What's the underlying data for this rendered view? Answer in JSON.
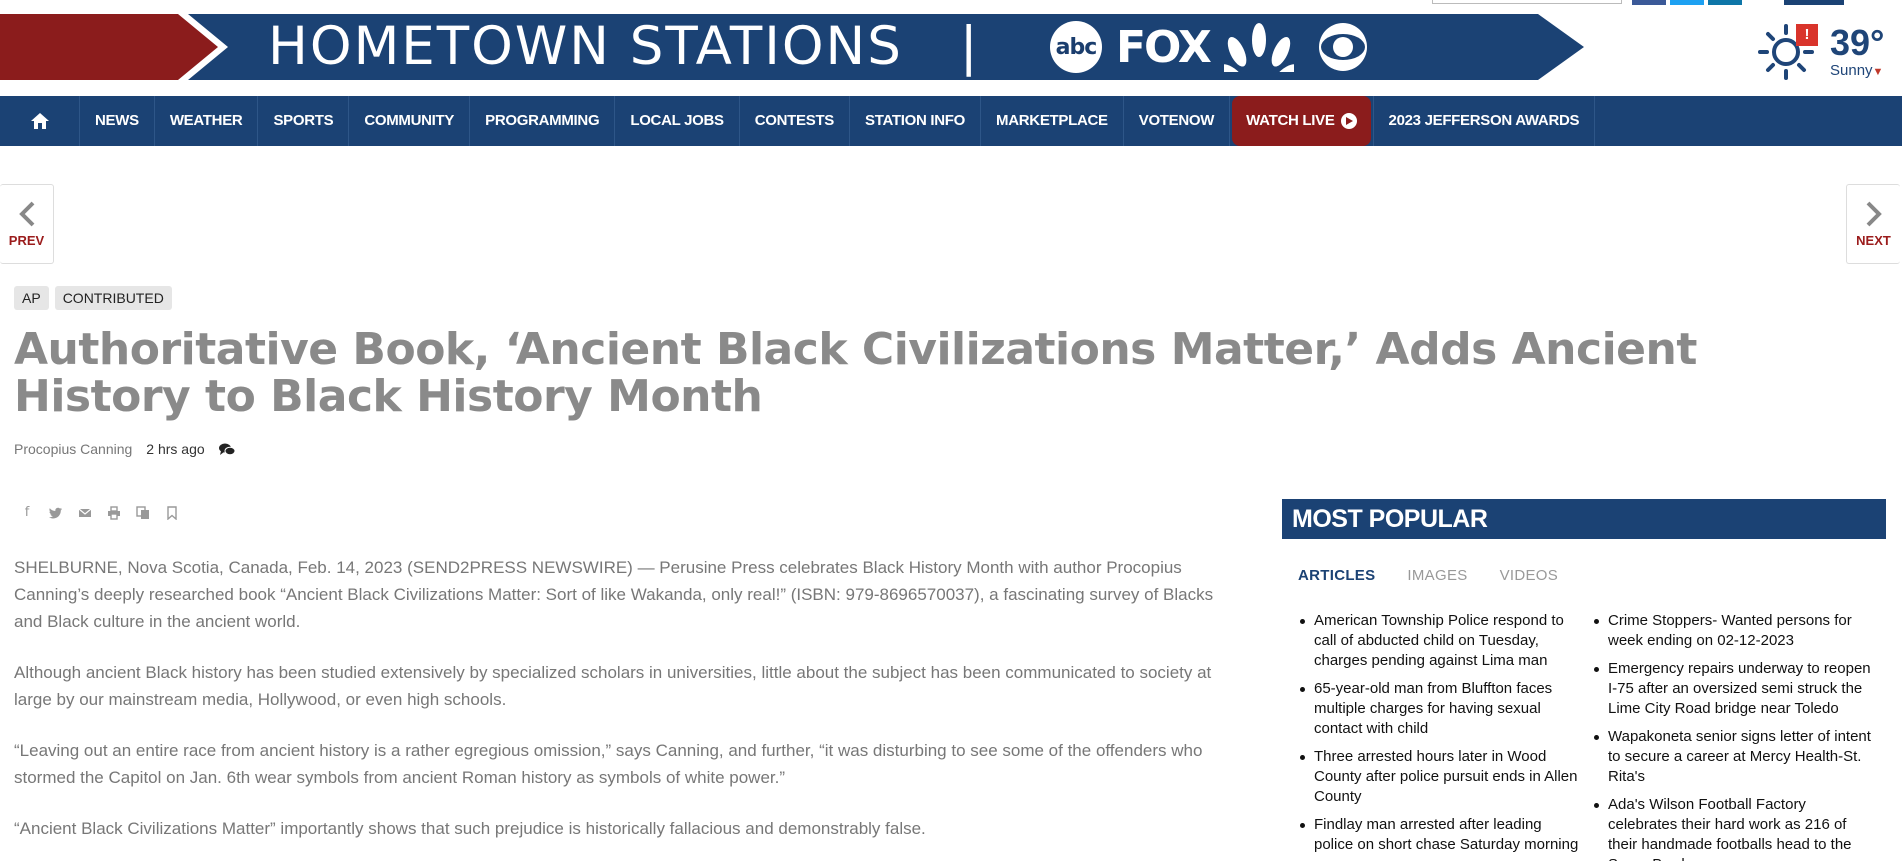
{
  "banner": {
    "title": "HOMETOWN STATIONS",
    "separator": "|",
    "logos": {
      "abc": "abc",
      "fox": "FOX"
    },
    "colors": {
      "arrow_red": "#8b1c1c",
      "arrow_blue": "#1b4274"
    }
  },
  "weather": {
    "temperature": "39°",
    "condition": "Sunny",
    "alert": "!"
  },
  "nav": {
    "items": [
      "NEWS",
      "WEATHER",
      "SPORTS",
      "COMMUNITY",
      "PROGRAMMING",
      "LOCAL JOBS",
      "CONTESTS",
      "STATION INFO",
      "MARKETPLACE",
      "VOTENOW"
    ],
    "watch_live": "WATCH LIVE",
    "awards": "2023 JEFFERSON AWARDS"
  },
  "pager": {
    "prev": "PREV",
    "next": "NEXT"
  },
  "article": {
    "tags": [
      "AP",
      "CONTRIBUTED"
    ],
    "headline": "Authoritative Book, ‘Ancient Black Civilizations Matter,’ Adds Ancient History to Black History Month",
    "author": "Procopius Canning",
    "time": "2 hrs ago",
    "paragraphs": [
      "SHELBURNE, Nova Scotia, Canada, Feb. 14, 2023 (SEND2PRESS NEWSWIRE) — Perusine Press celebrates Black History Month with author Procopius Canning’s deeply researched book “Ancient Black Civilizations Matter: Sort of like Wakanda, only real!” (ISBN: 979-8696570037), a fascinating survey of Blacks and Black culture in the ancient world.",
      "Although ancient Black history has been studied extensively by specialized scholars in universities, little about the subject has been communicated to society at large by our mainstream media, Hollywood, or even high schools.",
      "“Leaving out an entire race from ancient history is a rather egregious omission,” says Canning, and further, “it was disturbing to see some of the offenders who stormed the Capitol on Jan. 6th wear symbols from ancient Roman history as symbols of white power.”",
      "“Ancient Black Civilizations Matter” importantly shows that such prejudice is historically fallacious and demonstrably false."
    ]
  },
  "popular": {
    "title": "MOST POPULAR",
    "tabs": [
      "ARTICLES",
      "IMAGES",
      "VIDEOS"
    ],
    "left": [
      "American Township Police respond to call of abducted child on Tuesday, charges pending against Lima man",
      "65-year-old man from Bluffton faces multiple charges for having sexual contact with child",
      "Three arrested hours later in Wood County after police pursuit ends in Allen County",
      "Findlay man arrested after leading police on short chase Saturday morning"
    ],
    "right": [
      "Crime Stoppers- Wanted persons for week ending on 02-12-2023",
      "Emergency repairs underway to reopen I-75 after an oversized semi struck the Lime City Road bridge near Toledo",
      "Wapakoneta senior signs letter of intent to secure a career at Mercy Health-St. Rita's",
      "Ada's Wilson Football Factory celebrates their hard work as 216 of their handmade footballs head to the Super Bowl"
    ]
  }
}
